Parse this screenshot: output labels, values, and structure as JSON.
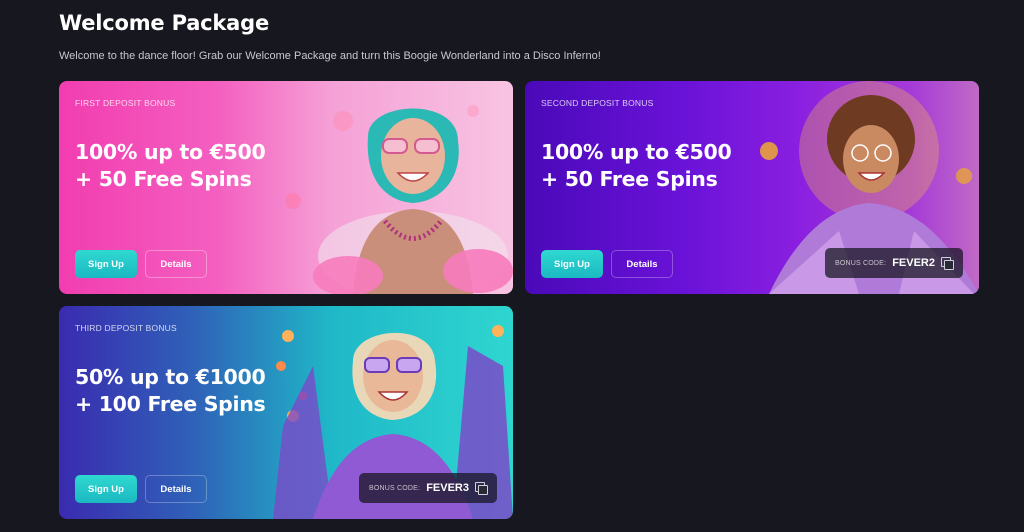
{
  "page": {
    "title": "Welcome Package",
    "subtitle": "Welcome to the dance floor! Grab our Welcome Package and turn this Boogie Wonderland into a Disco Inferno!"
  },
  "cards": [
    {
      "label": "FIRST DEPOSIT BONUS",
      "headline_line1": "100% up to €500",
      "headline_line2": "+ 50 Free Spins",
      "signup_label": "Sign Up",
      "details_label": "Details"
    },
    {
      "label": "SECOND DEPOSIT BONUS",
      "headline_line1": "100% up to €500",
      "headline_line2": "+ 50 Free Spins",
      "signup_label": "Sign Up",
      "details_label": "Details",
      "bonus_code_label": "BONUS CODE:",
      "bonus_code": "FEVER2"
    },
    {
      "label": "THIRD DEPOSIT BONUS",
      "headline_line1": "50% up to €1000",
      "headline_line2": "+ 100 Free Spins",
      "signup_label": "Sign Up",
      "details_label": "Details",
      "bonus_code_label": "BONUS CODE:",
      "bonus_code": "FEVER3"
    }
  ],
  "colors": {
    "background": "#17171f",
    "accent": "#2fd9d0"
  }
}
